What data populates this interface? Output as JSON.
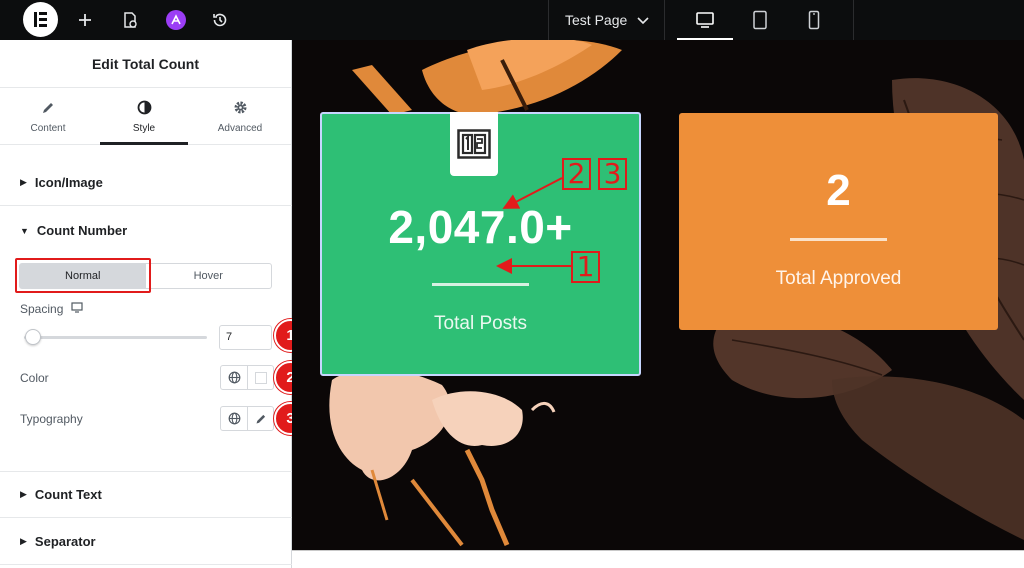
{
  "topbar": {
    "page_name": "Test Page",
    "icons": [
      "elementor-logo-icon",
      "add-icon",
      "page-settings-icon",
      "site-settings-icon",
      "history-icon",
      "chevron-down-icon",
      "desktop-icon",
      "tablet-icon",
      "mobile-icon"
    ],
    "active_device": "desktop"
  },
  "panel": {
    "title": "Edit Total Count",
    "tabs": [
      {
        "label": "Content",
        "icon": "pencil-icon"
      },
      {
        "label": "Style",
        "icon": "contrast-icon",
        "active": true
      },
      {
        "label": "Advanced",
        "icon": "gear-icon"
      }
    ],
    "sections": {
      "icon_image": "Icon/Image",
      "count_number": "Count Number",
      "count_text": "Count Text",
      "separator": "Separator"
    },
    "state_toggle": {
      "normal": "Normal",
      "hover": "Hover",
      "active": "Normal"
    },
    "spacing": {
      "label": "Spacing",
      "value": "7",
      "slider_fraction": 0.07
    },
    "color": {
      "label": "Color",
      "swatch": "#ffffff"
    },
    "typography": {
      "label": "Typography"
    }
  },
  "annotations": {
    "badges": [
      "1",
      "2",
      "3"
    ],
    "canvas_labels": [
      "1",
      "2",
      "3"
    ],
    "color": "#e11b1b"
  },
  "canvas": {
    "card1": {
      "number": "2,047.0+",
      "label": "Total Posts",
      "background": "#2ebf75",
      "icon": "counter-numbers-icon"
    },
    "card2": {
      "number": "2",
      "label": "Total Approved",
      "background": "#ee8f39"
    }
  }
}
